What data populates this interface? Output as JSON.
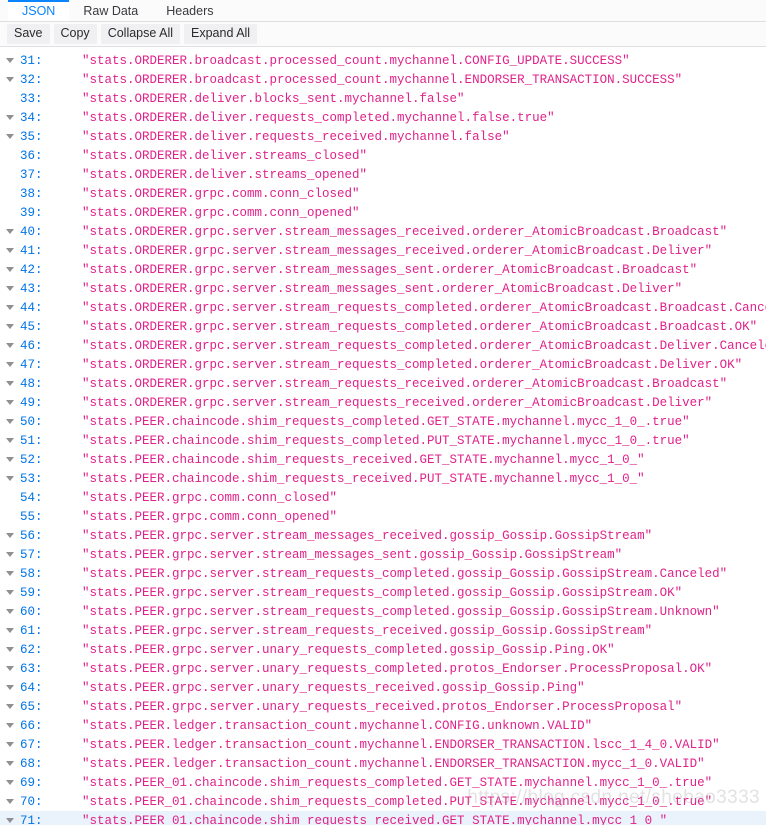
{
  "tabs": [
    {
      "label": "JSON",
      "active": true
    },
    {
      "label": "Raw Data",
      "active": false
    },
    {
      "label": "Headers",
      "active": false
    }
  ],
  "toolbar": {
    "save_label": "Save",
    "copy_label": "Copy",
    "collapse_all_label": "Collapse All",
    "expand_all_label": "Expand All"
  },
  "colors": {
    "accent": "#0a84ff",
    "index": "#0074e8",
    "string": "#e0218a",
    "row_highlight": "#eaf3fb",
    "toolbar_bg": "#fbfbfb"
  },
  "watermark": "https://blog.csdn.net/shebao3333",
  "json_rows": [
    {
      "index": "31:",
      "expandable": true,
      "value": "\"stats.ORDERER.broadcast.processed_count.mychannel.CONFIG_UPDATE.SUCCESS\""
    },
    {
      "index": "32:",
      "expandable": true,
      "value": "\"stats.ORDERER.broadcast.processed_count.mychannel.ENDORSER_TRANSACTION.SUCCESS\""
    },
    {
      "index": "33:",
      "expandable": false,
      "value": "\"stats.ORDERER.deliver.blocks_sent.mychannel.false\""
    },
    {
      "index": "34:",
      "expandable": true,
      "value": "\"stats.ORDERER.deliver.requests_completed.mychannel.false.true\""
    },
    {
      "index": "35:",
      "expandable": true,
      "value": "\"stats.ORDERER.deliver.requests_received.mychannel.false\""
    },
    {
      "index": "36:",
      "expandable": false,
      "value": "\"stats.ORDERER.deliver.streams_closed\""
    },
    {
      "index": "37:",
      "expandable": false,
      "value": "\"stats.ORDERER.deliver.streams_opened\""
    },
    {
      "index": "38:",
      "expandable": false,
      "value": "\"stats.ORDERER.grpc.comm.conn_closed\""
    },
    {
      "index": "39:",
      "expandable": false,
      "value": "\"stats.ORDERER.grpc.comm.conn_opened\""
    },
    {
      "index": "40:",
      "expandable": true,
      "value": "\"stats.ORDERER.grpc.server.stream_messages_received.orderer_AtomicBroadcast.Broadcast\""
    },
    {
      "index": "41:",
      "expandable": true,
      "value": "\"stats.ORDERER.grpc.server.stream_messages_received.orderer_AtomicBroadcast.Deliver\""
    },
    {
      "index": "42:",
      "expandable": true,
      "value": "\"stats.ORDERER.grpc.server.stream_messages_sent.orderer_AtomicBroadcast.Broadcast\""
    },
    {
      "index": "43:",
      "expandable": true,
      "value": "\"stats.ORDERER.grpc.server.stream_messages_sent.orderer_AtomicBroadcast.Deliver\""
    },
    {
      "index": "44:",
      "expandable": true,
      "value": "\"stats.ORDERER.grpc.server.stream_requests_completed.orderer_AtomicBroadcast.Broadcast.Canceled\""
    },
    {
      "index": "45:",
      "expandable": true,
      "value": "\"stats.ORDERER.grpc.server.stream_requests_completed.orderer_AtomicBroadcast.Broadcast.OK\""
    },
    {
      "index": "46:",
      "expandable": true,
      "value": "\"stats.ORDERER.grpc.server.stream_requests_completed.orderer_AtomicBroadcast.Deliver.Canceled\""
    },
    {
      "index": "47:",
      "expandable": true,
      "value": "\"stats.ORDERER.grpc.server.stream_requests_completed.orderer_AtomicBroadcast.Deliver.OK\""
    },
    {
      "index": "48:",
      "expandable": true,
      "value": "\"stats.ORDERER.grpc.server.stream_requests_received.orderer_AtomicBroadcast.Broadcast\""
    },
    {
      "index": "49:",
      "expandable": true,
      "value": "\"stats.ORDERER.grpc.server.stream_requests_received.orderer_AtomicBroadcast.Deliver\""
    },
    {
      "index": "50:",
      "expandable": true,
      "value": "\"stats.PEER.chaincode.shim_requests_completed.GET_STATE.mychannel.mycc_1_0_.true\""
    },
    {
      "index": "51:",
      "expandable": true,
      "value": "\"stats.PEER.chaincode.shim_requests_completed.PUT_STATE.mychannel.mycc_1_0_.true\""
    },
    {
      "index": "52:",
      "expandable": true,
      "value": "\"stats.PEER.chaincode.shim_requests_received.GET_STATE.mychannel.mycc_1_0_\""
    },
    {
      "index": "53:",
      "expandable": true,
      "value": "\"stats.PEER.chaincode.shim_requests_received.PUT_STATE.mychannel.mycc_1_0_\""
    },
    {
      "index": "54:",
      "expandable": false,
      "value": "\"stats.PEER.grpc.comm.conn_closed\""
    },
    {
      "index": "55:",
      "expandable": false,
      "value": "\"stats.PEER.grpc.comm.conn_opened\""
    },
    {
      "index": "56:",
      "expandable": true,
      "value": "\"stats.PEER.grpc.server.stream_messages_received.gossip_Gossip.GossipStream\""
    },
    {
      "index": "57:",
      "expandable": true,
      "value": "\"stats.PEER.grpc.server.stream_messages_sent.gossip_Gossip.GossipStream\""
    },
    {
      "index": "58:",
      "expandable": true,
      "value": "\"stats.PEER.grpc.server.stream_requests_completed.gossip_Gossip.GossipStream.Canceled\""
    },
    {
      "index": "59:",
      "expandable": true,
      "value": "\"stats.PEER.grpc.server.stream_requests_completed.gossip_Gossip.GossipStream.OK\""
    },
    {
      "index": "60:",
      "expandable": true,
      "value": "\"stats.PEER.grpc.server.stream_requests_completed.gossip_Gossip.GossipStream.Unknown\""
    },
    {
      "index": "61:",
      "expandable": true,
      "value": "\"stats.PEER.grpc.server.stream_requests_received.gossip_Gossip.GossipStream\""
    },
    {
      "index": "62:",
      "expandable": true,
      "value": "\"stats.PEER.grpc.server.unary_requests_completed.gossip_Gossip.Ping.OK\""
    },
    {
      "index": "63:",
      "expandable": true,
      "value": "\"stats.PEER.grpc.server.unary_requests_completed.protos_Endorser.ProcessProposal.OK\""
    },
    {
      "index": "64:",
      "expandable": true,
      "value": "\"stats.PEER.grpc.server.unary_requests_received.gossip_Gossip.Ping\""
    },
    {
      "index": "65:",
      "expandable": true,
      "value": "\"stats.PEER.grpc.server.unary_requests_received.protos_Endorser.ProcessProposal\""
    },
    {
      "index": "66:",
      "expandable": true,
      "value": "\"stats.PEER.ledger.transaction_count.mychannel.CONFIG.unknown.VALID\""
    },
    {
      "index": "67:",
      "expandable": true,
      "value": "\"stats.PEER.ledger.transaction_count.mychannel.ENDORSER_TRANSACTION.lscc_1_4_0.VALID\""
    },
    {
      "index": "68:",
      "expandable": true,
      "value": "\"stats.PEER.ledger.transaction_count.mychannel.ENDORSER_TRANSACTION.mycc_1_0.VALID\""
    },
    {
      "index": "69:",
      "expandable": true,
      "value": "\"stats.PEER_01.chaincode.shim_requests_completed.GET_STATE.mychannel.mycc_1_0_.true\""
    },
    {
      "index": "70:",
      "expandable": true,
      "value": "\"stats.PEER_01.chaincode.shim_requests_completed.PUT_STATE.mychannel.mycc_1_0_.true\""
    },
    {
      "index": "71:",
      "expandable": true,
      "highlight": true,
      "value": "\"stats.PEER_01.chaincode.shim_requests_received.GET_STATE.mychannel.mycc_1_0_\""
    }
  ]
}
